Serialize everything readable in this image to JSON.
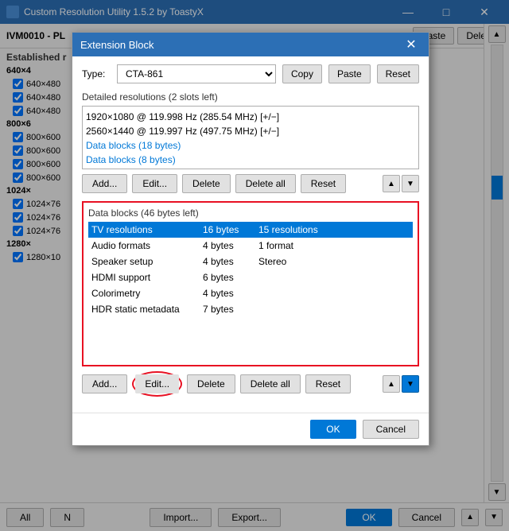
{
  "app": {
    "title": "Custom Resolution Utility 1.5.2 by ToastyX",
    "title_icon": "CRU",
    "main_monitor": "IVM0010 - PL"
  },
  "toolbar": {
    "paste_label": "Paste",
    "delete_label": "Delete"
  },
  "main_footer": {
    "all_label": "All",
    "n_label": "N",
    "import_label": "Import...",
    "export_label": "Export...",
    "ok_label": "OK",
    "cancel_label": "Cancel"
  },
  "resolution_groups": [
    {
      "label": "640×4",
      "items": [
        {
          "checked": true,
          "label": "640×480"
        },
        {
          "checked": true,
          "label": "640×480"
        },
        {
          "checked": true,
          "label": "640×480"
        }
      ]
    },
    {
      "label": "800×6",
      "items": [
        {
          "checked": true,
          "label": "800×600"
        },
        {
          "checked": true,
          "label": "800×600"
        },
        {
          "checked": true,
          "label": "800×600"
        },
        {
          "checked": true,
          "label": "800×600"
        }
      ]
    },
    {
      "label": "1024×",
      "items": [
        {
          "checked": true,
          "label": "1024×76"
        },
        {
          "checked": true,
          "label": "1024×76"
        },
        {
          "checked": true,
          "label": "1024×76"
        }
      ]
    },
    {
      "label": "1280×",
      "items": [
        {
          "checked": true,
          "label": "1280×10"
        }
      ]
    }
  ],
  "dialog": {
    "title": "Extension Block",
    "type_label": "Type:",
    "type_value": "CTA-861",
    "copy_label": "Copy",
    "paste_label": "Paste",
    "reset_label": "Reset",
    "detail_section_label": "Detailed resolutions (2 slots left)",
    "detail_items": [
      "1920×1080 @ 119.998 Hz (285.54 MHz) [+/−]",
      "2560×1440 @ 119.997 Hz (497.75 MHz) [+/−]"
    ],
    "detail_links": [
      "Data blocks (18 bytes)",
      "Data blocks (8 bytes)"
    ],
    "detail_buttons": {
      "add": "Add...",
      "edit": "Edit...",
      "delete": "Delete",
      "delete_all": "Delete all",
      "reset": "Reset"
    },
    "data_blocks_label": "Data blocks (46 bytes left)",
    "data_table": [
      {
        "name": "TV resolutions",
        "size": "16 bytes",
        "detail": "15 resolutions",
        "selected": true
      },
      {
        "name": "Audio formats",
        "size": "4 bytes",
        "detail": "1 format",
        "selected": false
      },
      {
        "name": "Speaker setup",
        "size": "4 bytes",
        "detail": "Stereo",
        "selected": false
      },
      {
        "name": "HDMI support",
        "size": "6 bytes",
        "detail": "",
        "selected": false
      },
      {
        "name": "Colorimetry",
        "size": "4 bytes",
        "detail": "",
        "selected": false
      },
      {
        "name": "HDR static metadata",
        "size": "7 bytes",
        "detail": "",
        "selected": false
      }
    ],
    "bottom_buttons": {
      "add": "Add...",
      "edit": "Edit...",
      "delete": "Delete",
      "delete_all": "Delete all",
      "reset": "Reset"
    },
    "footer": {
      "ok": "OK",
      "cancel": "Cancel"
    }
  },
  "icons": {
    "close": "✕",
    "minimize": "—",
    "maximize": "□",
    "arrow_up": "▲",
    "arrow_down": "▼",
    "chevron_down": "▾"
  }
}
